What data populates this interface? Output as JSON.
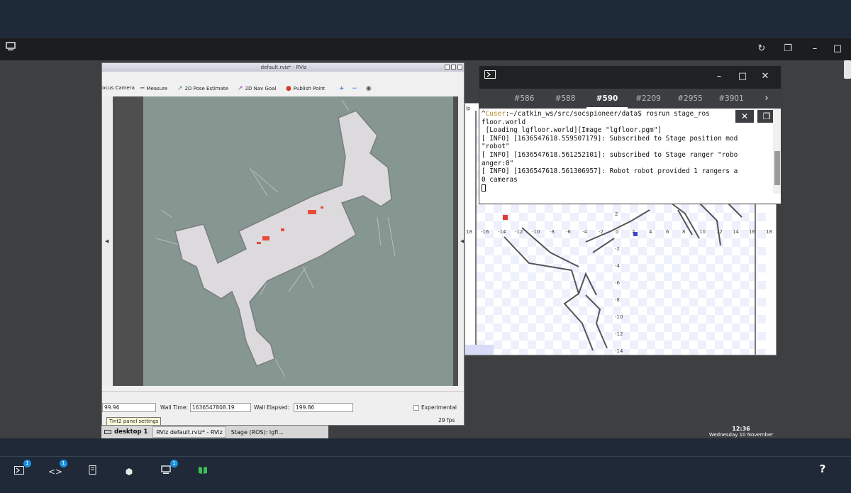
{
  "rviz": {
    "title": "default.rviz* - RViz",
    "tools": [
      {
        "icon": "camera-icon",
        "label": "ocus Camera"
      },
      {
        "icon": "ruler-icon",
        "label": "Measure"
      },
      {
        "icon": "arrow-green-icon",
        "label": "2D Pose Estimate"
      },
      {
        "icon": "arrow-purple-icon",
        "label": "2D Nav Goal"
      },
      {
        "icon": "pin-icon",
        "label": "Publish Point"
      }
    ],
    "ros_time_value": "99.96",
    "wall_time_label": "Wall Time:",
    "wall_time_value": "1636547808.19",
    "wall_elapsed_label": "Wall Elapsed:",
    "wall_elapsed_value": "199.86",
    "experimental_label": "Experimental",
    "fps": "29 fps",
    "tooltip": "Tint2 panel settings"
  },
  "terminal": {
    "tabs": [
      "#586",
      "#588",
      "#590",
      "#2209",
      "#2955",
      "#3901"
    ],
    "active_tab": "#590",
    "prompt_user": "Cuser",
    "lines": [
      "^Cuser:~/catkin_ws/src/socspioneer/data$ rosrun stage_ros",
      "floor.world",
      " [Loading lgfloor.world][Image \"lgfloor.pgm\"]",
      "[ INFO] [1636547618.559507179]: Subscribed to Stage position mod",
      "\"robot\"",
      "[ INFO] [1636547618.561252101]: subscribed to Stage ranger \"robo",
      "anger:0\"",
      "[ INFO] [1636547618.561306957]: Robot robot provided 1 rangers a",
      "0 cameras"
    ]
  },
  "stage": {
    "axis_x": [
      "-16",
      "-14",
      "-12",
      "-10",
      "-8",
      "-6",
      "-4",
      "-2",
      "0",
      "2",
      "4",
      "6",
      "8",
      "10",
      "12",
      "14",
      "16",
      "18"
    ],
    "axis_y": [
      "2",
      "-2",
      "-4",
      "-6",
      "-8",
      "-10",
      "-12",
      "-14"
    ],
    "side_labels": [
      "18",
      "18",
      "lp"
    ]
  },
  "taskbar": {
    "desktop": "desktop 1",
    "items": [
      "RViz default.rviz* - RViz",
      "Stage (ROS): lgfl..."
    ]
  },
  "clock": {
    "time": "12:36",
    "date": "Wednesday 10 November"
  },
  "dock": {
    "items": [
      {
        "icon": "terminal-icon",
        "badge": "1"
      },
      {
        "icon": "code-icon",
        "badge": "1"
      },
      {
        "icon": "notebook-icon",
        "badge": ""
      },
      {
        "icon": "cube-icon",
        "badge": ""
      },
      {
        "icon": "desktop-icon",
        "badge": "1"
      },
      {
        "icon": "book-icon",
        "badge": ""
      }
    ],
    "help": "?"
  },
  "colors": {
    "dock_bg": "#1f2937",
    "map_bg": "#869691",
    "badge": "#1d8fe0",
    "prompt_user": "#b58a1e"
  }
}
